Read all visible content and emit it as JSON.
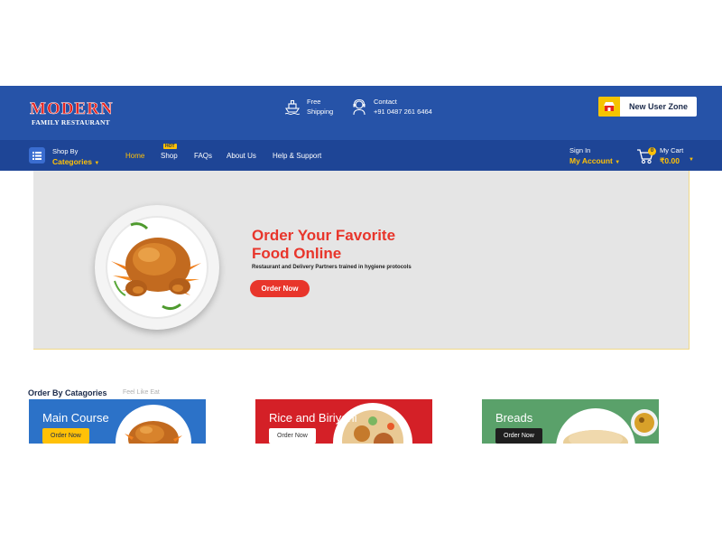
{
  "colors": {
    "header_bg": "#2653a8",
    "nav_bg": "#1e4596",
    "accent_yellow": "#ffc107",
    "accent_red": "#e8352b",
    "hero_bg": "#e5e5e5"
  },
  "header": {
    "logo": {
      "main": "MODERN",
      "sub": "FAMILY RESTAURANT"
    },
    "shipping": {
      "icon": "ship-icon",
      "line1": "Free",
      "line2": "Shipping"
    },
    "contact": {
      "icon": "support-agent-icon",
      "line1": "Contact",
      "line2": "+91 0487 261 6464"
    },
    "new_user": {
      "icon": "store-icon",
      "label": "New User Zone"
    }
  },
  "nav": {
    "categories": {
      "icon": "menu-list-icon",
      "top": "Shop By",
      "label": "Categories"
    },
    "menu": [
      {
        "label": "Home",
        "active": true
      },
      {
        "label": "Shop",
        "badge": "HOT"
      },
      {
        "label": "FAQs"
      },
      {
        "label": "About Us"
      },
      {
        "label": "Help & Support"
      }
    ],
    "account": {
      "top": "Sign In",
      "label": "My Account"
    },
    "cart": {
      "icon": "cart-icon",
      "count": "0",
      "top": "My Cart",
      "total": "₹0.00"
    }
  },
  "hero": {
    "title_line1": "Order Your Favorite",
    "title_line2": "Food Online",
    "subtitle": "Restaurant and Delivery Partners trained in hygiene protocols",
    "button": "Order Now"
  },
  "categories": {
    "title": "Order By Catagories",
    "subtitle": "Feel Like Eat",
    "items": [
      {
        "title": "Main Course",
        "button": "Order Now",
        "color": "#2c72c8"
      },
      {
        "title": "Rice and Biriyani",
        "button": "Order Now",
        "color": "#d42027"
      },
      {
        "title": "Breads",
        "button": "Order Now",
        "color": "#5aa16a"
      }
    ]
  }
}
